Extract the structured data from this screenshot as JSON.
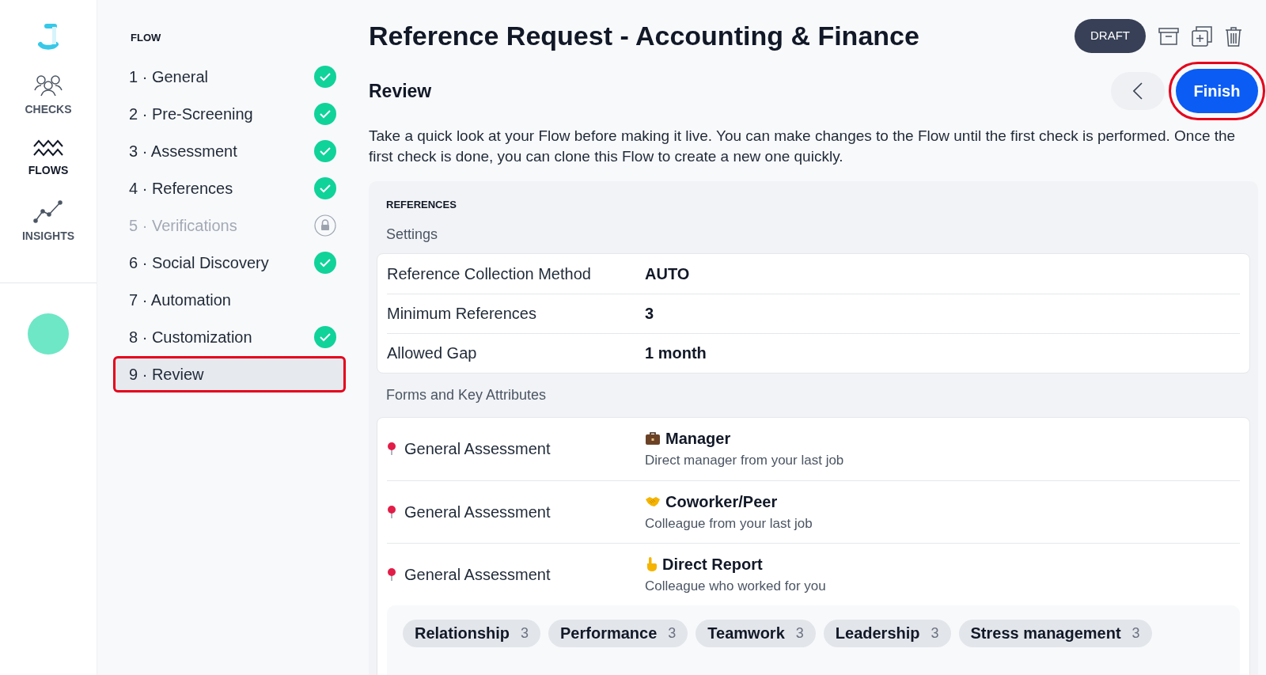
{
  "rail": {
    "items": [
      {
        "kind": "checks",
        "label": "CHECKS",
        "selected": false
      },
      {
        "kind": "flows",
        "label": "FLOWS",
        "selected": true
      },
      {
        "kind": "insights",
        "label": "INSIGHTS",
        "selected": false
      }
    ]
  },
  "flow_nav": {
    "heading": "FLOW",
    "steps": [
      {
        "label": "1 · General",
        "done": true,
        "locked": false,
        "selected": false,
        "highlighted": false
      },
      {
        "label": "2 · Pre-Screening",
        "done": true,
        "locked": false,
        "selected": false,
        "highlighted": false
      },
      {
        "label": "3 · Assessment",
        "done": true,
        "locked": false,
        "selected": false,
        "highlighted": false
      },
      {
        "label": "4 · References",
        "done": true,
        "locked": false,
        "selected": false,
        "highlighted": false
      },
      {
        "label": "5 · Verifications",
        "done": false,
        "locked": true,
        "selected": false,
        "highlighted": false
      },
      {
        "label": "6 · Social Discovery",
        "done": true,
        "locked": false,
        "selected": false,
        "highlighted": false
      },
      {
        "label": "7 · Automation",
        "done": false,
        "locked": false,
        "selected": false,
        "highlighted": false
      },
      {
        "label": "8 · Customization",
        "done": true,
        "locked": false,
        "selected": false,
        "highlighted": false
      },
      {
        "label": "9 · Review",
        "done": false,
        "locked": false,
        "selected": true,
        "highlighted": true
      }
    ]
  },
  "header": {
    "title": "Reference Request - Accounting & Finance",
    "status_badge": "DRAFT",
    "subtitle": "Review",
    "finish_button": {
      "label": "Finish",
      "highlighted": true
    },
    "description": "Take a quick look at your Flow before making it live. You can make changes to the Flow until the first check is performed. Once the first check is done, you can clone this Flow to create a new one quickly."
  },
  "section": {
    "title": "REFERENCES",
    "settings_label": "Settings",
    "settings": [
      {
        "name": "Reference Collection Method",
        "value": "AUTO"
      },
      {
        "name": "Minimum References",
        "value": "3"
      },
      {
        "name": "Allowed Gap",
        "value": "1 month"
      }
    ],
    "forms_label": "Forms and Key Attributes",
    "forms": [
      {
        "form": "General Assessment",
        "kind": "briefcase",
        "title": "Manager",
        "description": "Direct manager from your last job"
      },
      {
        "form": "General Assessment",
        "kind": "handshake",
        "title": "Coworker/Peer",
        "description": "Colleague from your last job"
      },
      {
        "form": "General Assessment",
        "kind": "pointing",
        "title": "Direct Report",
        "description": "Colleague who worked for you"
      }
    ],
    "attributes": [
      {
        "name": "Relationship",
        "count": "3"
      },
      {
        "name": "Performance",
        "count": "3"
      },
      {
        "name": "Teamwork",
        "count": "3"
      },
      {
        "name": "Leadership",
        "count": "3"
      },
      {
        "name": "Stress management",
        "count": "3"
      }
    ]
  }
}
